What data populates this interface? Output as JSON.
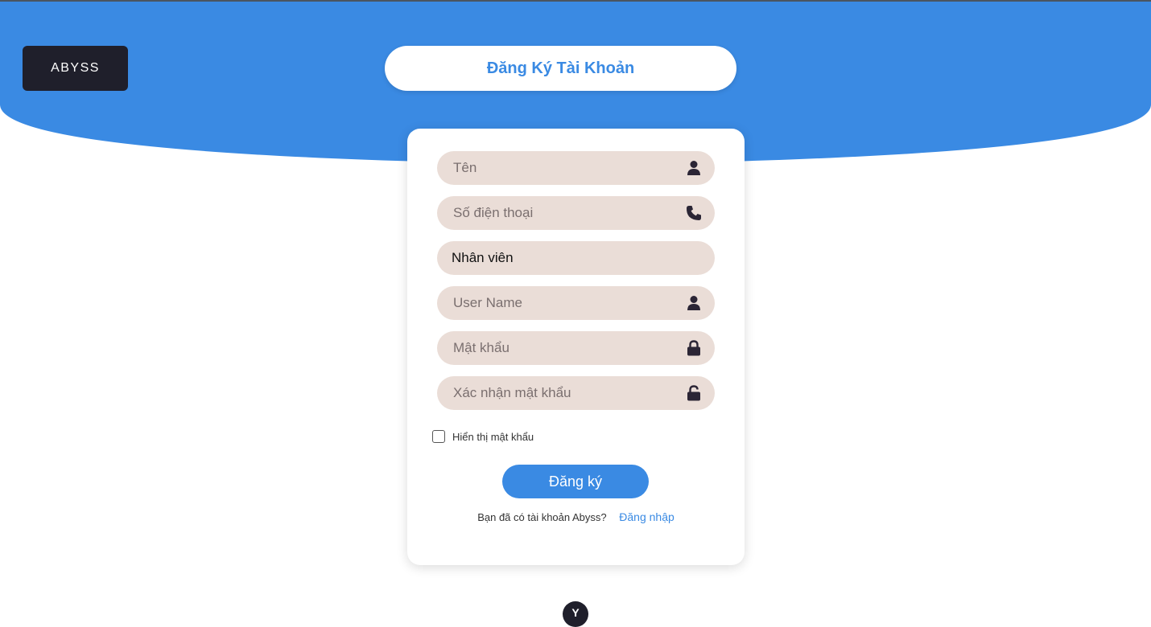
{
  "brand": {
    "logo_text": "ABYSS"
  },
  "header": {
    "title": "Đăng Ký Tài Khoản"
  },
  "form": {
    "name": {
      "placeholder": "Tên",
      "value": ""
    },
    "phone": {
      "placeholder": "Số điện thoại",
      "value": ""
    },
    "role": {
      "selected": "Nhân viên"
    },
    "username": {
      "placeholder": "User Name",
      "value": ""
    },
    "password": {
      "placeholder": "Mật khẩu",
      "value": ""
    },
    "confirm_password": {
      "placeholder": "Xác nhận mật khẩu",
      "value": ""
    },
    "show_password_label": "Hiển thị mật khẩu",
    "show_password_checked": false,
    "submit_label": "Đăng ký",
    "login_prompt": "Bạn đã có tài khoản Abyss?",
    "login_link": "Đăng nhập"
  },
  "bottom_badge": {
    "text": "Y"
  },
  "icons": {
    "name": "user-icon",
    "phone": "phone-icon",
    "username": "user-icon",
    "password": "lock-icon",
    "confirm_password": "unlock-icon"
  },
  "colors": {
    "accent": "#3a8ae3",
    "field_bg": "#eaddd7",
    "icon": "#2b2535",
    "logo_bg": "#1f1f2b"
  }
}
